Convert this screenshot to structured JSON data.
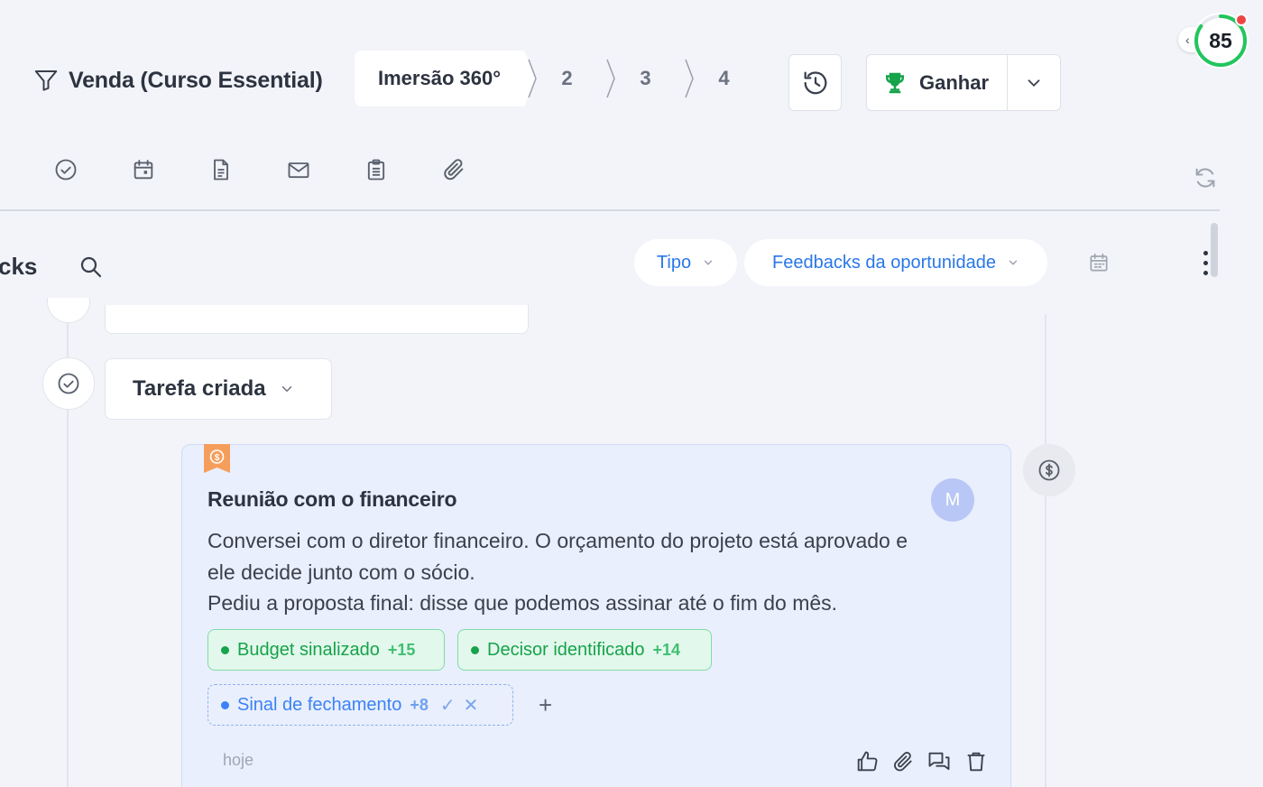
{
  "header": {
    "pipeline_title": "Venda (Curso Essential)",
    "stages": [
      {
        "label": "Imersão 360°",
        "active": true
      },
      {
        "label": "2",
        "active": false
      },
      {
        "label": "3",
        "active": false
      },
      {
        "label": "4",
        "active": false
      }
    ],
    "win_label": "Ganhar",
    "score": "85"
  },
  "toolbar": {
    "icons": [
      "check-circle-icon",
      "calendar-icon",
      "document-icon",
      "mail-icon",
      "clipboard-icon",
      "paperclip-icon"
    ]
  },
  "feed": {
    "label": "cks",
    "filter_tipo": "Tipo",
    "filter_feedback": "Feedbacks da oportunidade"
  },
  "timeline": {
    "task_label": "Tarefa criada",
    "feedback": {
      "title": "Reunião com o financeiro",
      "avatar": "M",
      "body_lines": [
        "Conversei com o diretor financeiro. O orçamento do projeto está aprovado e",
        "ele decide junto com o sócio.",
        "Pediu a proposta final: disse que podemos assinar até o fim do mês."
      ],
      "tags": [
        {
          "label": "Budget sinalizado",
          "points": "+15",
          "state": "confirmed"
        },
        {
          "label": "Decisor identificado",
          "points": "+14",
          "state": "confirmed"
        },
        {
          "label": "Sinal de fechamento",
          "points": "+8",
          "state": "suggested"
        }
      ],
      "add_symbol": "+",
      "date": "hoje"
    }
  },
  "colors": {
    "background": "#f2f4f9",
    "accent_blue": "#2a77e8",
    "success_green": "#16a34a",
    "score_ring": "#22c55e",
    "bookmark_orange": "#f59e5b"
  }
}
